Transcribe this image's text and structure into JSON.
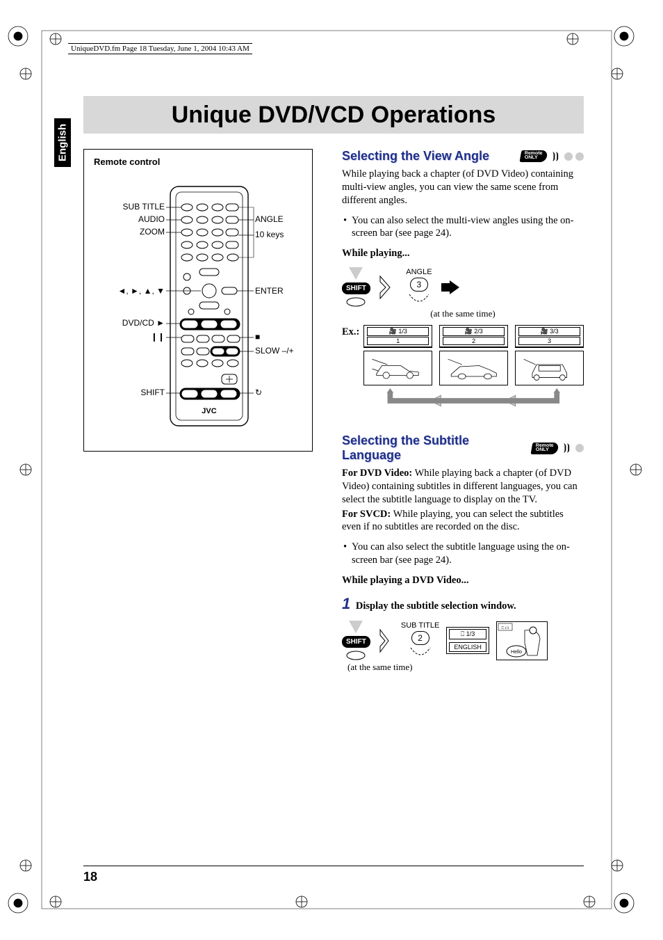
{
  "header_line": "UniqueDVD.fm  Page 18  Tuesday, June 1, 2004  10:43 AM",
  "language_tab": "English",
  "page_title": "Unique DVD/VCD Operations",
  "page_number": "18",
  "remote": {
    "box_title": "Remote control",
    "labels_left": [
      "SUB TITLE",
      "AUDIO",
      "ZOOM",
      "DVD/CD ►",
      "❙❙",
      "SHIFT"
    ],
    "cursor_label": "◄, ►, ▲, ▼",
    "labels_right": [
      "ANGLE",
      "10 keys",
      "ENTER",
      "■",
      "SLOW –/+"
    ],
    "brand": "JVC",
    "repeat_icon": "↻"
  },
  "badge": {
    "line1": "Remote",
    "line2": "ONLY"
  },
  "section1": {
    "title": "Selecting the View Angle",
    "para": "While playing back a chapter (of DVD Video) containing multi-view angles, you can view the same scene from different angles.",
    "bullet": "You can also select the multi-view angles using the on-screen bar (see page 24).",
    "subhead": "While playing...",
    "shift_label": "SHIFT",
    "angle_label": "ANGLE",
    "button_num": "3",
    "same_time": "(at the same time)",
    "ex_label": "Ex.:",
    "angles": [
      {
        "top": "🎥 1/3",
        "num": "1"
      },
      {
        "top": "🎥 2/3",
        "num": "2"
      },
      {
        "top": "🎥 3/3",
        "num": "3"
      }
    ]
  },
  "section2": {
    "title": "Selecting the Subtitle Language",
    "para1_label": "For DVD Video:",
    "para1": " While playing back a chapter (of DVD Video) containing subtitles in different languages, you can select the subtitle language to display on the TV.",
    "para2_label": "For SVCD:",
    "para2": " While playing, you can select the subtitles even if no subtitles are recorded on the disc.",
    "bullet": "You can also select the subtitle language using the on-screen bar (see page 24).",
    "subhead": "While playing a DVD Video...",
    "step_num": "1",
    "step_text": " Display the subtitle selection window.",
    "shift_label": "SHIFT",
    "subtitle_label": "SUB TITLE",
    "button_num": "2",
    "same_time": "(at the same time)",
    "display": {
      "top": "⎕ 1/3",
      "lang": "ENGLISH"
    },
    "bubble": "Hello"
  }
}
